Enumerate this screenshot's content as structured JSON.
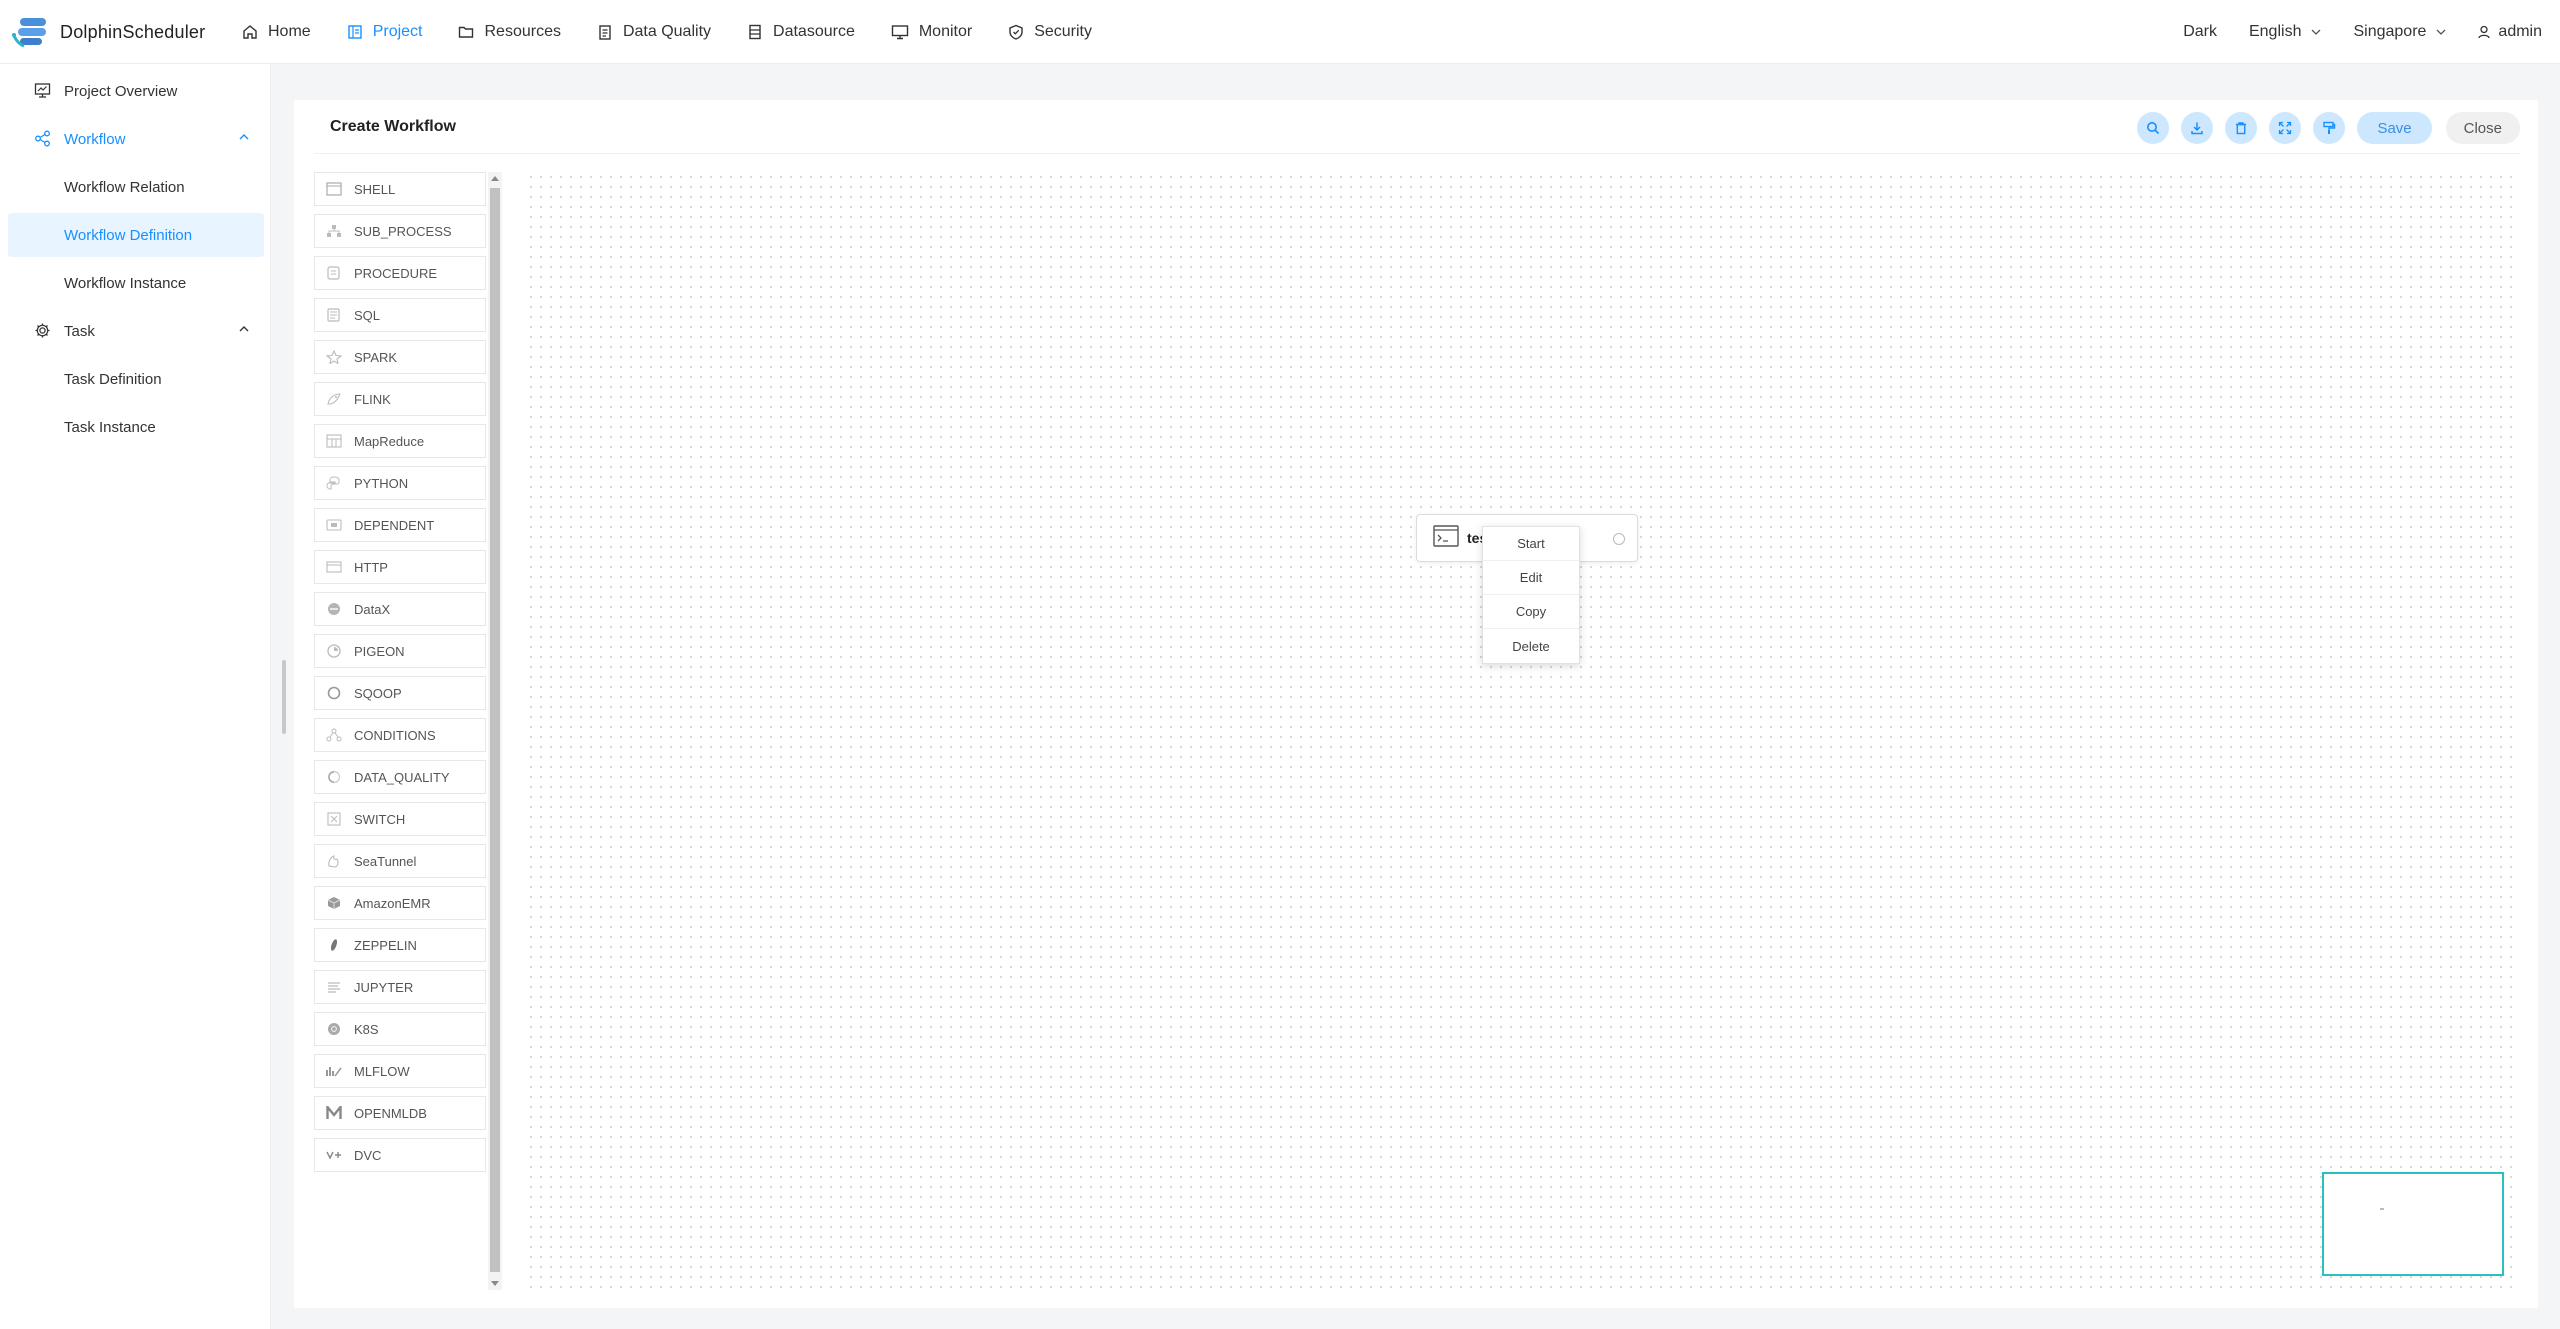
{
  "app": {
    "name": "DolphinScheduler"
  },
  "nav": {
    "items": [
      {
        "label": "Home",
        "icon": "home-icon"
      },
      {
        "label": "Project",
        "icon": "project-icon",
        "active": true
      },
      {
        "label": "Resources",
        "icon": "folder-icon"
      },
      {
        "label": "Data Quality",
        "icon": "clipboard-icon"
      },
      {
        "label": "Datasource",
        "icon": "database-icon"
      },
      {
        "label": "Monitor",
        "icon": "monitor-icon"
      },
      {
        "label": "Security",
        "icon": "shield-icon"
      }
    ],
    "theme_label": "Dark",
    "language": "English",
    "timezone": "Singapore",
    "user": "admin"
  },
  "sidebar": {
    "items": [
      {
        "label": "Project Overview",
        "icon": "chart-icon"
      },
      {
        "label": "Workflow",
        "icon": "workflow-icon",
        "expanded": true,
        "children": [
          "Workflow Relation",
          "Workflow Definition",
          "Workflow Instance"
        ]
      },
      {
        "label": "Task",
        "icon": "gear-icon",
        "expanded": true,
        "children": [
          "Task Definition",
          "Task Instance"
        ]
      }
    ],
    "active": "Workflow Definition"
  },
  "editor": {
    "title": "Create Workflow",
    "save_label": "Save",
    "close_label": "Close",
    "toolbar_icons": [
      "search-icon",
      "download-icon",
      "delete-icon",
      "fullscreen-icon",
      "format-brush-icon"
    ]
  },
  "tasks": [
    "SHELL",
    "SUB_PROCESS",
    "PROCEDURE",
    "SQL",
    "SPARK",
    "FLINK",
    "MapReduce",
    "PYTHON",
    "DEPENDENT",
    "HTTP",
    "DataX",
    "PIGEON",
    "SQOOP",
    "CONDITIONS",
    "DATA_QUALITY",
    "SWITCH",
    "SeaTunnel",
    "AmazonEMR",
    "ZEPPELIN",
    "JUPYTER",
    "K8S",
    "MLFLOW",
    "OPENMLDB",
    "DVC"
  ],
  "canvas": {
    "node": {
      "label": "tes"
    },
    "context_menu": [
      "Start",
      "Edit",
      "Copy",
      "Delete"
    ]
  },
  "colors": {
    "accent": "#1890ff",
    "active_bg": "#e8f4ff",
    "minimap_border": "#28c0c0"
  }
}
